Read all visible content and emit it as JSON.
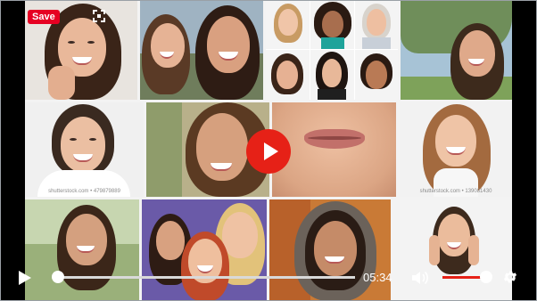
{
  "overlay": {
    "save_label": "Save",
    "expand_icon": "expand-icon",
    "play_icon": "play-icon"
  },
  "controls": {
    "time": "05:34",
    "play_icon": "play-icon",
    "volume_icon": "volume-icon",
    "settings_icon": "gear-icon",
    "progress": 0.0,
    "volume_level": 1.0
  },
  "thumbnails": {
    "captions": [
      "shutterstock.com • 479879889",
      "shutterstock.com • 139081430"
    ]
  },
  "colors": {
    "accent": "#e62117",
    "save_bg": "#e60023"
  }
}
